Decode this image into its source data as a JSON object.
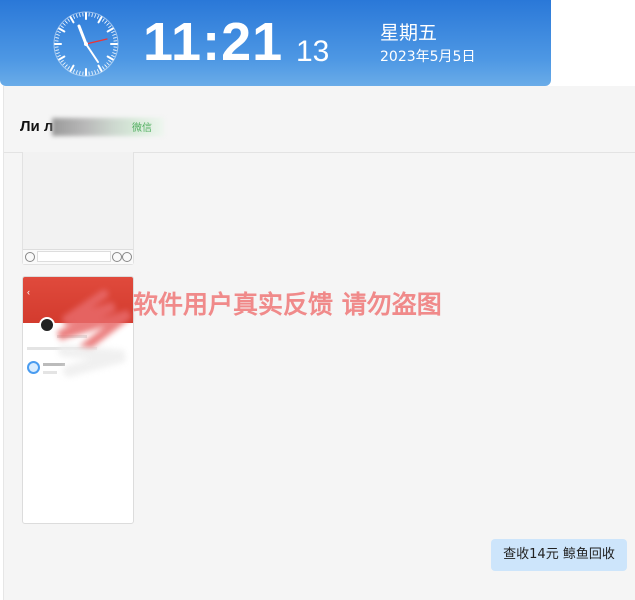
{
  "clock": {
    "time_hm": "11:21",
    "seconds": "13",
    "weekday": "星期五",
    "date": "2023年5月5日"
  },
  "chat": {
    "contact_name": "Ли л",
    "contact_tag": "微信"
  },
  "watermark": "软件用户真实反馈  请勿盗图",
  "message_bubble": "查收14元  鲸鱼回收",
  "colors": {
    "banner_blue": "#2a78d8",
    "bubble_blue": "#cde5fb",
    "watermark_red": "#f08a8a",
    "app_red": "#d33b2e"
  }
}
